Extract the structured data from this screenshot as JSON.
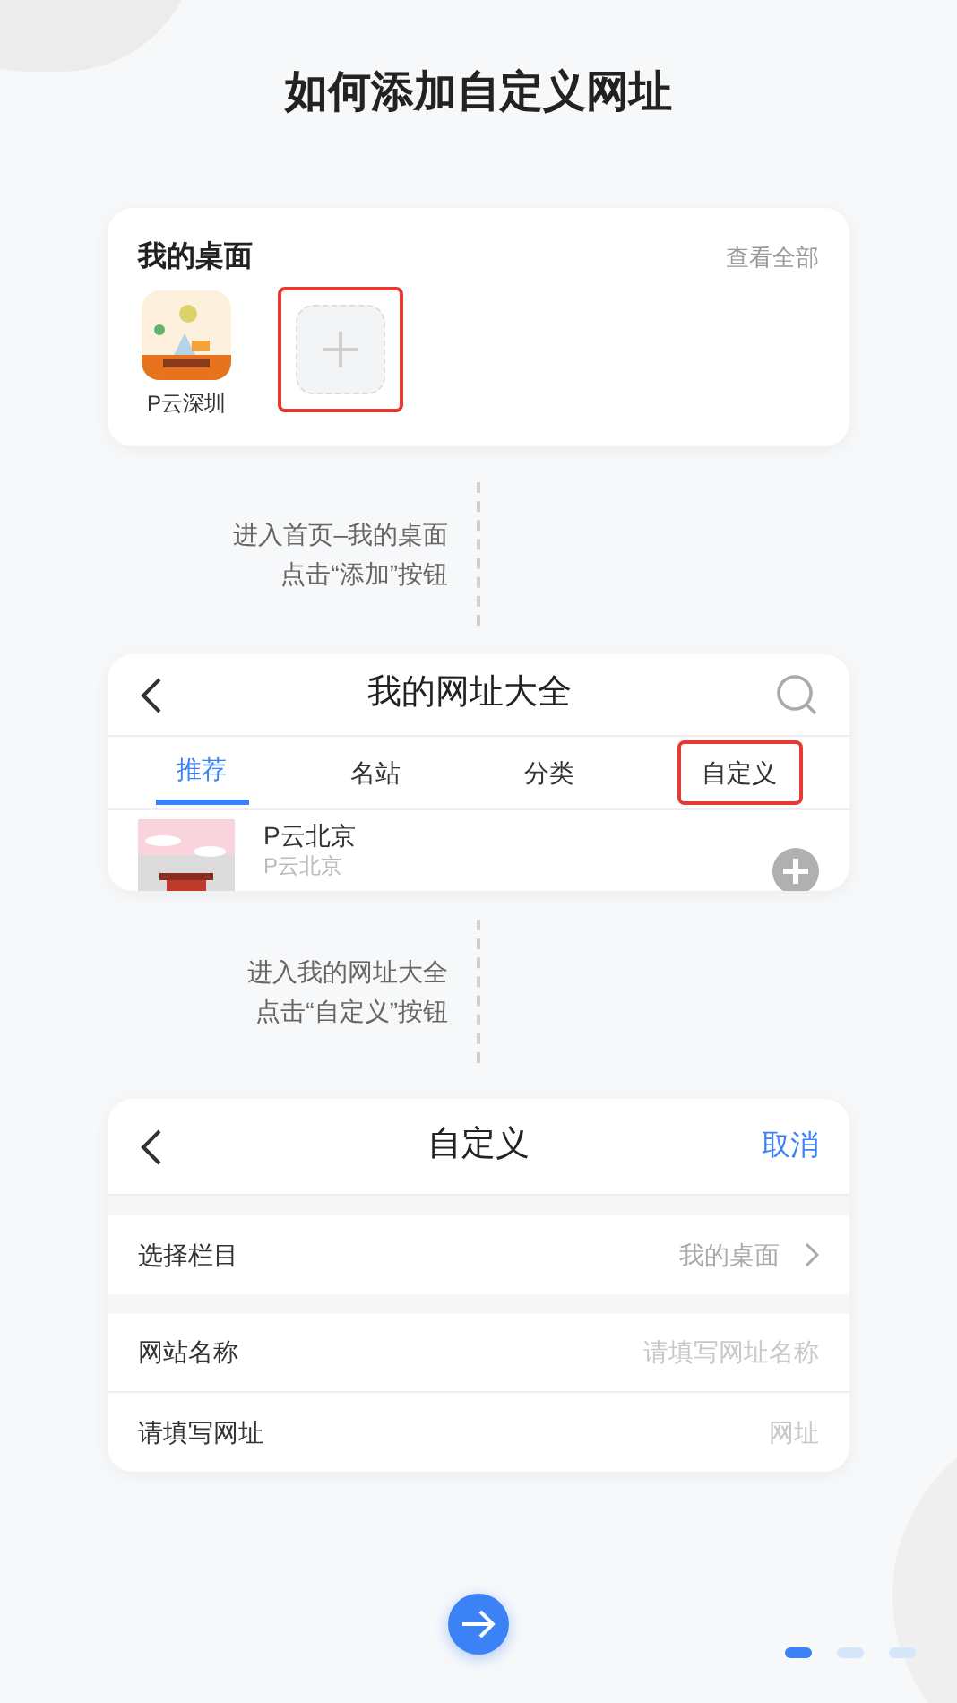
{
  "title": "如何添加自定义网址",
  "desktop_card": {
    "title": "我的桌面",
    "view_all": "查看全部",
    "apps": [
      {
        "kind": "app",
        "label": "P云深圳",
        "highlighted": false
      },
      {
        "kind": "add",
        "highlighted": true
      }
    ]
  },
  "caption_1": [
    "进入首页–我的桌面",
    "点击“添加”按钮"
  ],
  "sites_card": {
    "title": "我的网址大全",
    "tabs": [
      {
        "label": "推荐",
        "selected": true,
        "highlighted": false
      },
      {
        "label": "名站",
        "selected": false,
        "highlighted": false
      },
      {
        "label": "分类",
        "selected": false,
        "highlighted": false
      },
      {
        "label": "自定义",
        "selected": false,
        "highlighted": true
      }
    ],
    "row": {
      "name": "P云北京",
      "subtitle": "P云北京"
    }
  },
  "caption_2": [
    "进入我的网址大全",
    "点击“自定义”按钮"
  ],
  "custom_card": {
    "title": "自定义",
    "cancel": "取消",
    "rows": [
      {
        "kind": "select",
        "label": "选择栏目",
        "value": "我的桌面"
      },
      {
        "kind": "input",
        "label": "网站名称",
        "placeholder": "请填写网址名称"
      },
      {
        "kind": "input",
        "label": "请填写网址",
        "placeholder": "网址"
      }
    ]
  },
  "pager": [
    {
      "selected": true
    },
    {
      "selected": false
    },
    {
      "selected": false
    }
  ]
}
